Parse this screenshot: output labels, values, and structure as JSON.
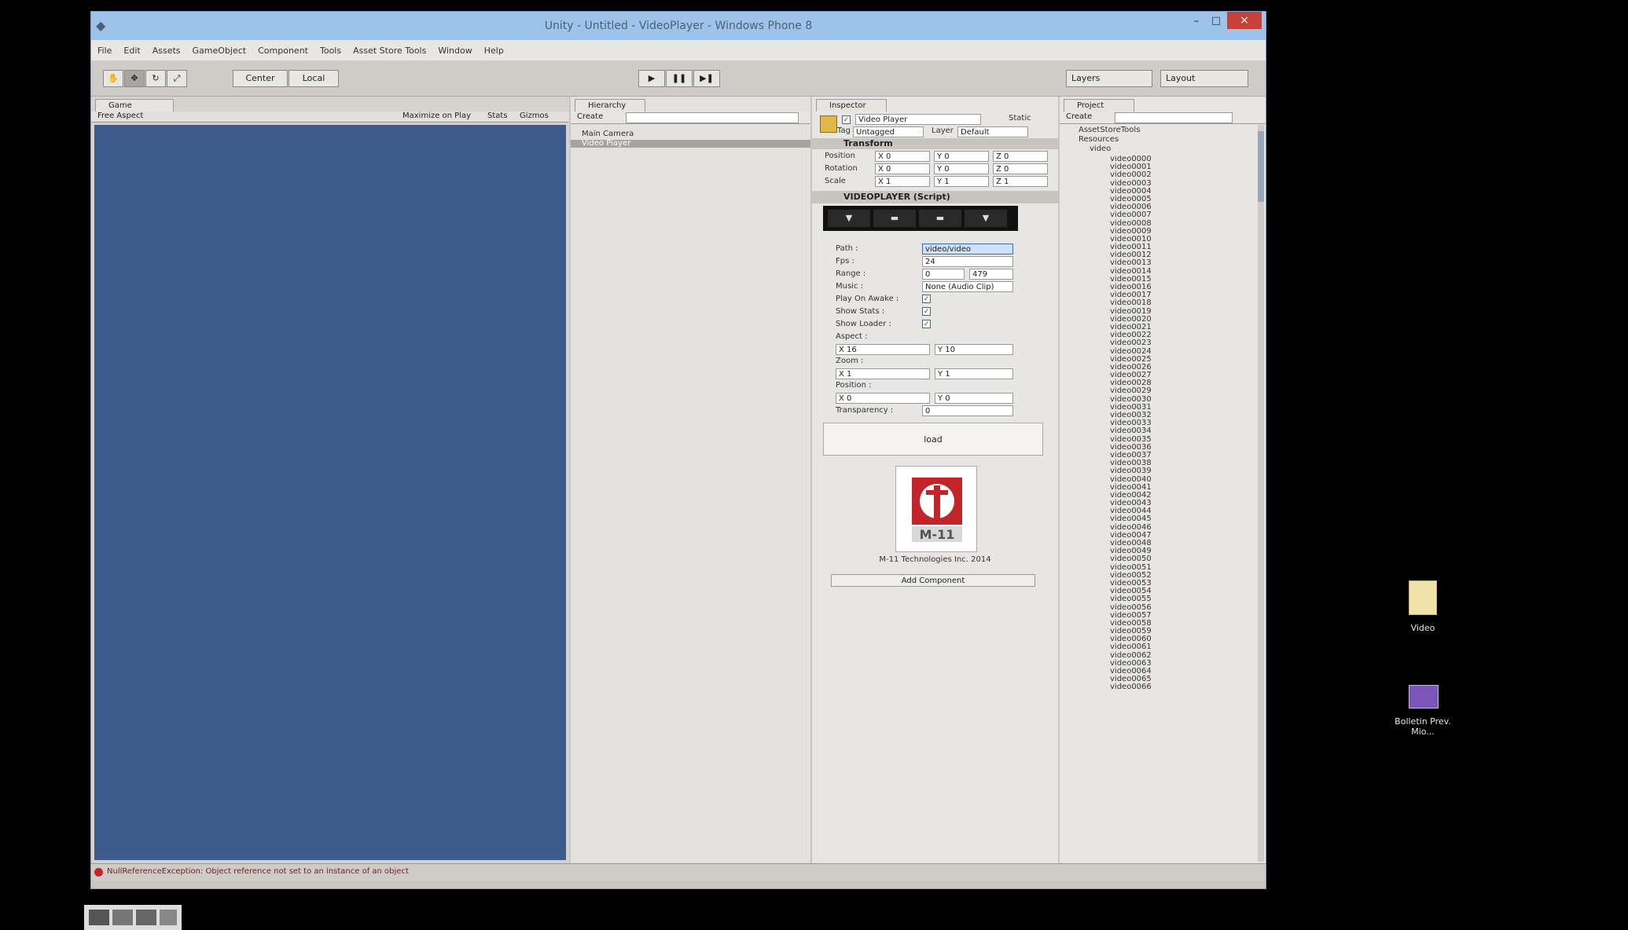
{
  "window": {
    "title": "Unity - Untitled - VideoPlayer - Windows Phone 8",
    "controls": [
      "–",
      "□",
      "×"
    ]
  },
  "menu": [
    "File",
    "Edit",
    "Assets",
    "GameObject",
    "Component",
    "Tools",
    "Asset Store Tools",
    "Window",
    "Help"
  ],
  "toolbar": {
    "center_label": "Center",
    "local_label": "Local",
    "play": "▶",
    "pause": "❚❚",
    "step": "▶❚",
    "layers_label": "Layers",
    "layout_label": "Layout"
  },
  "game": {
    "tab": "Game",
    "aspect": "Free Aspect",
    "maximize": "Maximize on Play",
    "stats": "Stats",
    "gizmos": "Gizmos"
  },
  "hierarchy": {
    "tab": "Hierarchy",
    "create": "Create",
    "items": [
      "Main Camera",
      "Video Player"
    ]
  },
  "inspector": {
    "tab": "Inspector",
    "object_name": "Video Player",
    "static_label": "Static",
    "tag_label": "Tag",
    "tag_value": "Untagged",
    "layer_label": "Layer",
    "layer_value": "Default",
    "transform": {
      "title": "Transform",
      "rows": [
        {
          "label": "Position",
          "x": "X 0",
          "y": "Y 0",
          "z": "Z 0"
        },
        {
          "label": "Rotation",
          "x": "X 0",
          "y": "Y 0",
          "z": "Z 0"
        },
        {
          "label": "Scale",
          "x": "X 1",
          "y": "Y 1",
          "z": "Z 1"
        }
      ]
    },
    "videoplayer": {
      "title": "VIDEOPLAYER (Script)",
      "path_label": "Path :",
      "path_value": "video/video",
      "fps_label": "Fps :",
      "fps_value": "24",
      "range_label": "Range :",
      "range_from": "0",
      "range_to": "479",
      "music_label": "Music :",
      "music_value": "None (Audio Clip)",
      "play_on_awake": "Play On Awake :",
      "show_stats": "Show Stats :",
      "show_loader": "Show Loader :",
      "aspect_label": "Aspect :",
      "aspect_x": "X 16",
      "aspect_y": "Y 10",
      "zoom_label": "Zoom :",
      "zoom_x": "X 1",
      "zoom_y": "Y 1",
      "position_label": "Position :",
      "position_x": "X 0",
      "position_y": "Y 0",
      "transparency_label": "Transparency :",
      "transparency_value": "0",
      "load_button": "load"
    },
    "logo_text": "M-11 Technologies Inc. 2014",
    "add_component": "Add Component"
  },
  "project": {
    "tab": "Project",
    "create": "Create",
    "folders": [
      "AssetStoreTools",
      "Resources",
      "video"
    ],
    "files": [
      "video0000",
      "video0001",
      "video0002",
      "video0003",
      "video0004",
      "video0005",
      "video0006",
      "video0007",
      "video0008",
      "video0009",
      "video0010",
      "video0011",
      "video0012",
      "video0013",
      "video0014",
      "video0015",
      "video0016",
      "video0017",
      "video0018",
      "video0019",
      "video0020",
      "video0021",
      "video0022",
      "video0023",
      "video0024",
      "video0025",
      "video0026",
      "video0027",
      "video0028",
      "video0029",
      "video0030",
      "video0031",
      "video0032",
      "video0033",
      "video0034",
      "video0035",
      "video0036",
      "video0037",
      "video0038",
      "video0039",
      "video0040",
      "video0041",
      "video0042",
      "video0043",
      "video0044",
      "video0045",
      "video0046",
      "video0047",
      "video0048",
      "video0049",
      "video0050",
      "video0051",
      "video0052",
      "video0053",
      "video0054",
      "video0055",
      "video0056",
      "video0057",
      "video0058",
      "video0059",
      "video0060",
      "video0061",
      "video0062",
      "video0063",
      "video0064",
      "video0065",
      "video0066"
    ]
  },
  "status": {
    "message": "NullReferenceException: Object reference not set to an instance of an object"
  },
  "desktop": {
    "icons": [
      {
        "label": "Video"
      },
      {
        "label": "Bolletin Prev. Mio..."
      }
    ]
  }
}
